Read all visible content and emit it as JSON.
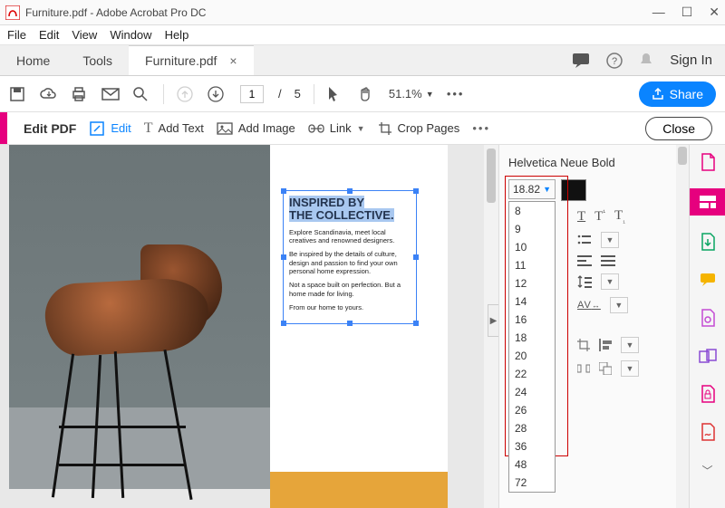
{
  "window": {
    "title": "Furniture.pdf - Adobe Acrobat Pro DC",
    "min": "—",
    "max": "☐",
    "close": "✕"
  },
  "menubar": [
    "File",
    "Edit",
    "View",
    "Window",
    "Help"
  ],
  "tabs": {
    "home": "Home",
    "tools": "Tools",
    "doc": "Furniture.pdf",
    "signin": "Sign In"
  },
  "toolbar": {
    "page_current": "1",
    "page_sep": "/",
    "page_total": "5",
    "zoom": "51.1%",
    "share": "Share"
  },
  "editbar": {
    "title": "Edit PDF",
    "edit": "Edit",
    "add_text": "Add Text",
    "add_image": "Add Image",
    "link": "Link",
    "crop": "Crop Pages",
    "close": "Close"
  },
  "doc_text": {
    "h1a": "INSPIRED BY",
    "h1b": "THE COLLECTIVE.",
    "p1": "Explore Scandinavia, meet local creatives and renowned designers.",
    "p2": "Be inspired by the details of culture, design and passion to find your own personal home expression.",
    "p3": "Not a space built on perfection. But a home made for living.",
    "p4": "From our home to yours."
  },
  "format": {
    "font": "Helvetica Neue Bold",
    "size_value": "18.82",
    "size_options": [
      "8",
      "9",
      "10",
      "11",
      "12",
      "14",
      "16",
      "18",
      "20",
      "22",
      "24",
      "26",
      "28",
      "36",
      "48",
      "72"
    ],
    "color": "#111111"
  }
}
